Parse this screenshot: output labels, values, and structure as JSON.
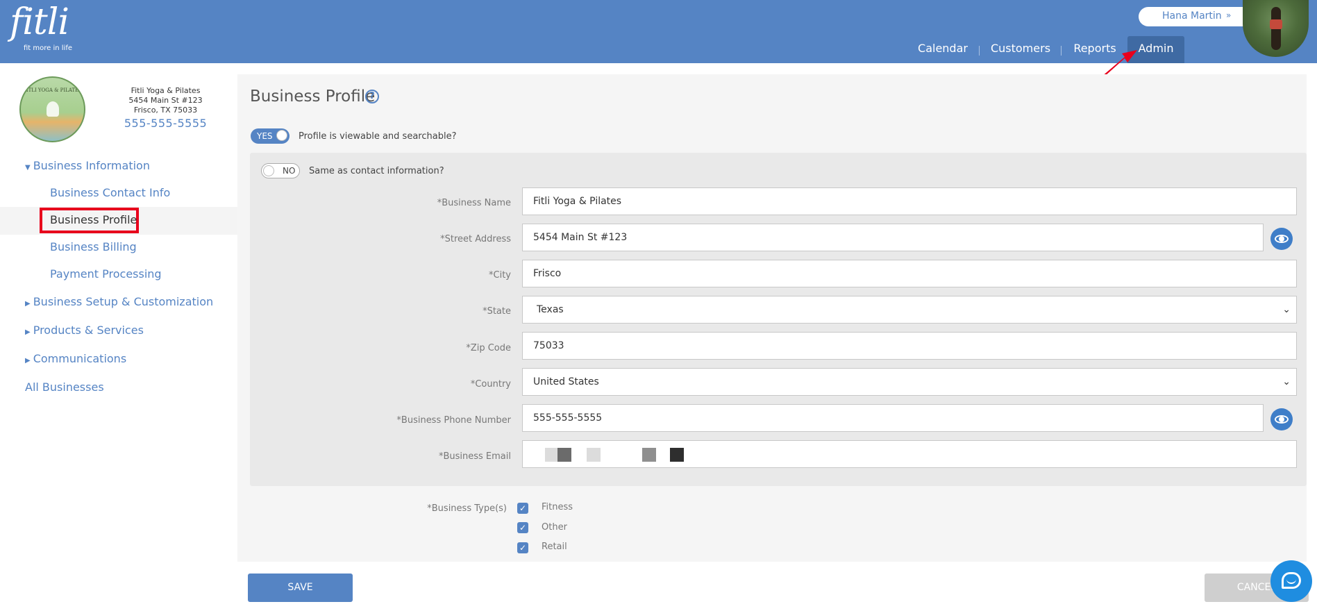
{
  "header": {
    "logo_text": "fitli",
    "logo_tagline": "fit more in life",
    "user_name": "Hana Martin",
    "user_chevron": "»",
    "nav": [
      "Calendar",
      "Customers",
      "Reports",
      "Admin"
    ],
    "active_nav": "Admin",
    "brand_color": "#5584c4"
  },
  "business": {
    "logo_text": "FITLI YOGA & PILATES",
    "name": "Fitli Yoga & Pilates",
    "address_line1": "5454 Main St #123",
    "address_line2": "Frisco, TX 75033",
    "phone": "555-555-5555"
  },
  "sidebar": {
    "section_business_information": "Business Information",
    "items": {
      "contact": "Business Contact Info",
      "profile": "Business Profile",
      "billing": "Business Billing",
      "payment": "Payment Processing"
    },
    "setup": "Business Setup & Customization",
    "products": "Products & Services",
    "communications": "Communications",
    "all_businesses": "All Businesses"
  },
  "main": {
    "title": "Business Profile",
    "help_icon": "?",
    "viewable_toggle": {
      "state": "YES",
      "label": "Profile is viewable and searchable?"
    },
    "same_contact_toggle": {
      "state": "NO",
      "label": "Same as contact information?"
    },
    "fields": {
      "business_name": {
        "label": "*Business Name",
        "value": "Fitli Yoga & Pilates"
      },
      "street": {
        "label": "*Street Address",
        "value": "5454 Main St #123"
      },
      "city": {
        "label": "*City",
        "value": "Frisco"
      },
      "state": {
        "label": "*State",
        "value": "Texas"
      },
      "zip": {
        "label": "*Zip Code",
        "value": "75033"
      },
      "country": {
        "label": "*Country",
        "value": "United States"
      },
      "phone": {
        "label": "*Business Phone Number",
        "value": "555-555-5555"
      },
      "email": {
        "label": "*Business Email"
      }
    },
    "business_types_label": "*Business Type(s)",
    "business_types": [
      "Fitness",
      "Other",
      "Retail"
    ]
  },
  "footer": {
    "save_label": "SAVE",
    "cancel_label": "CANCEL"
  },
  "icons": {
    "eye": "eye-icon",
    "chat": "chat-icon",
    "check": "✓",
    "dropdown": "⌄"
  },
  "colors": {
    "highlight_box": "#e8001c",
    "eye_button": "#3f7ec8",
    "chat_button": "#1f8de0"
  }
}
